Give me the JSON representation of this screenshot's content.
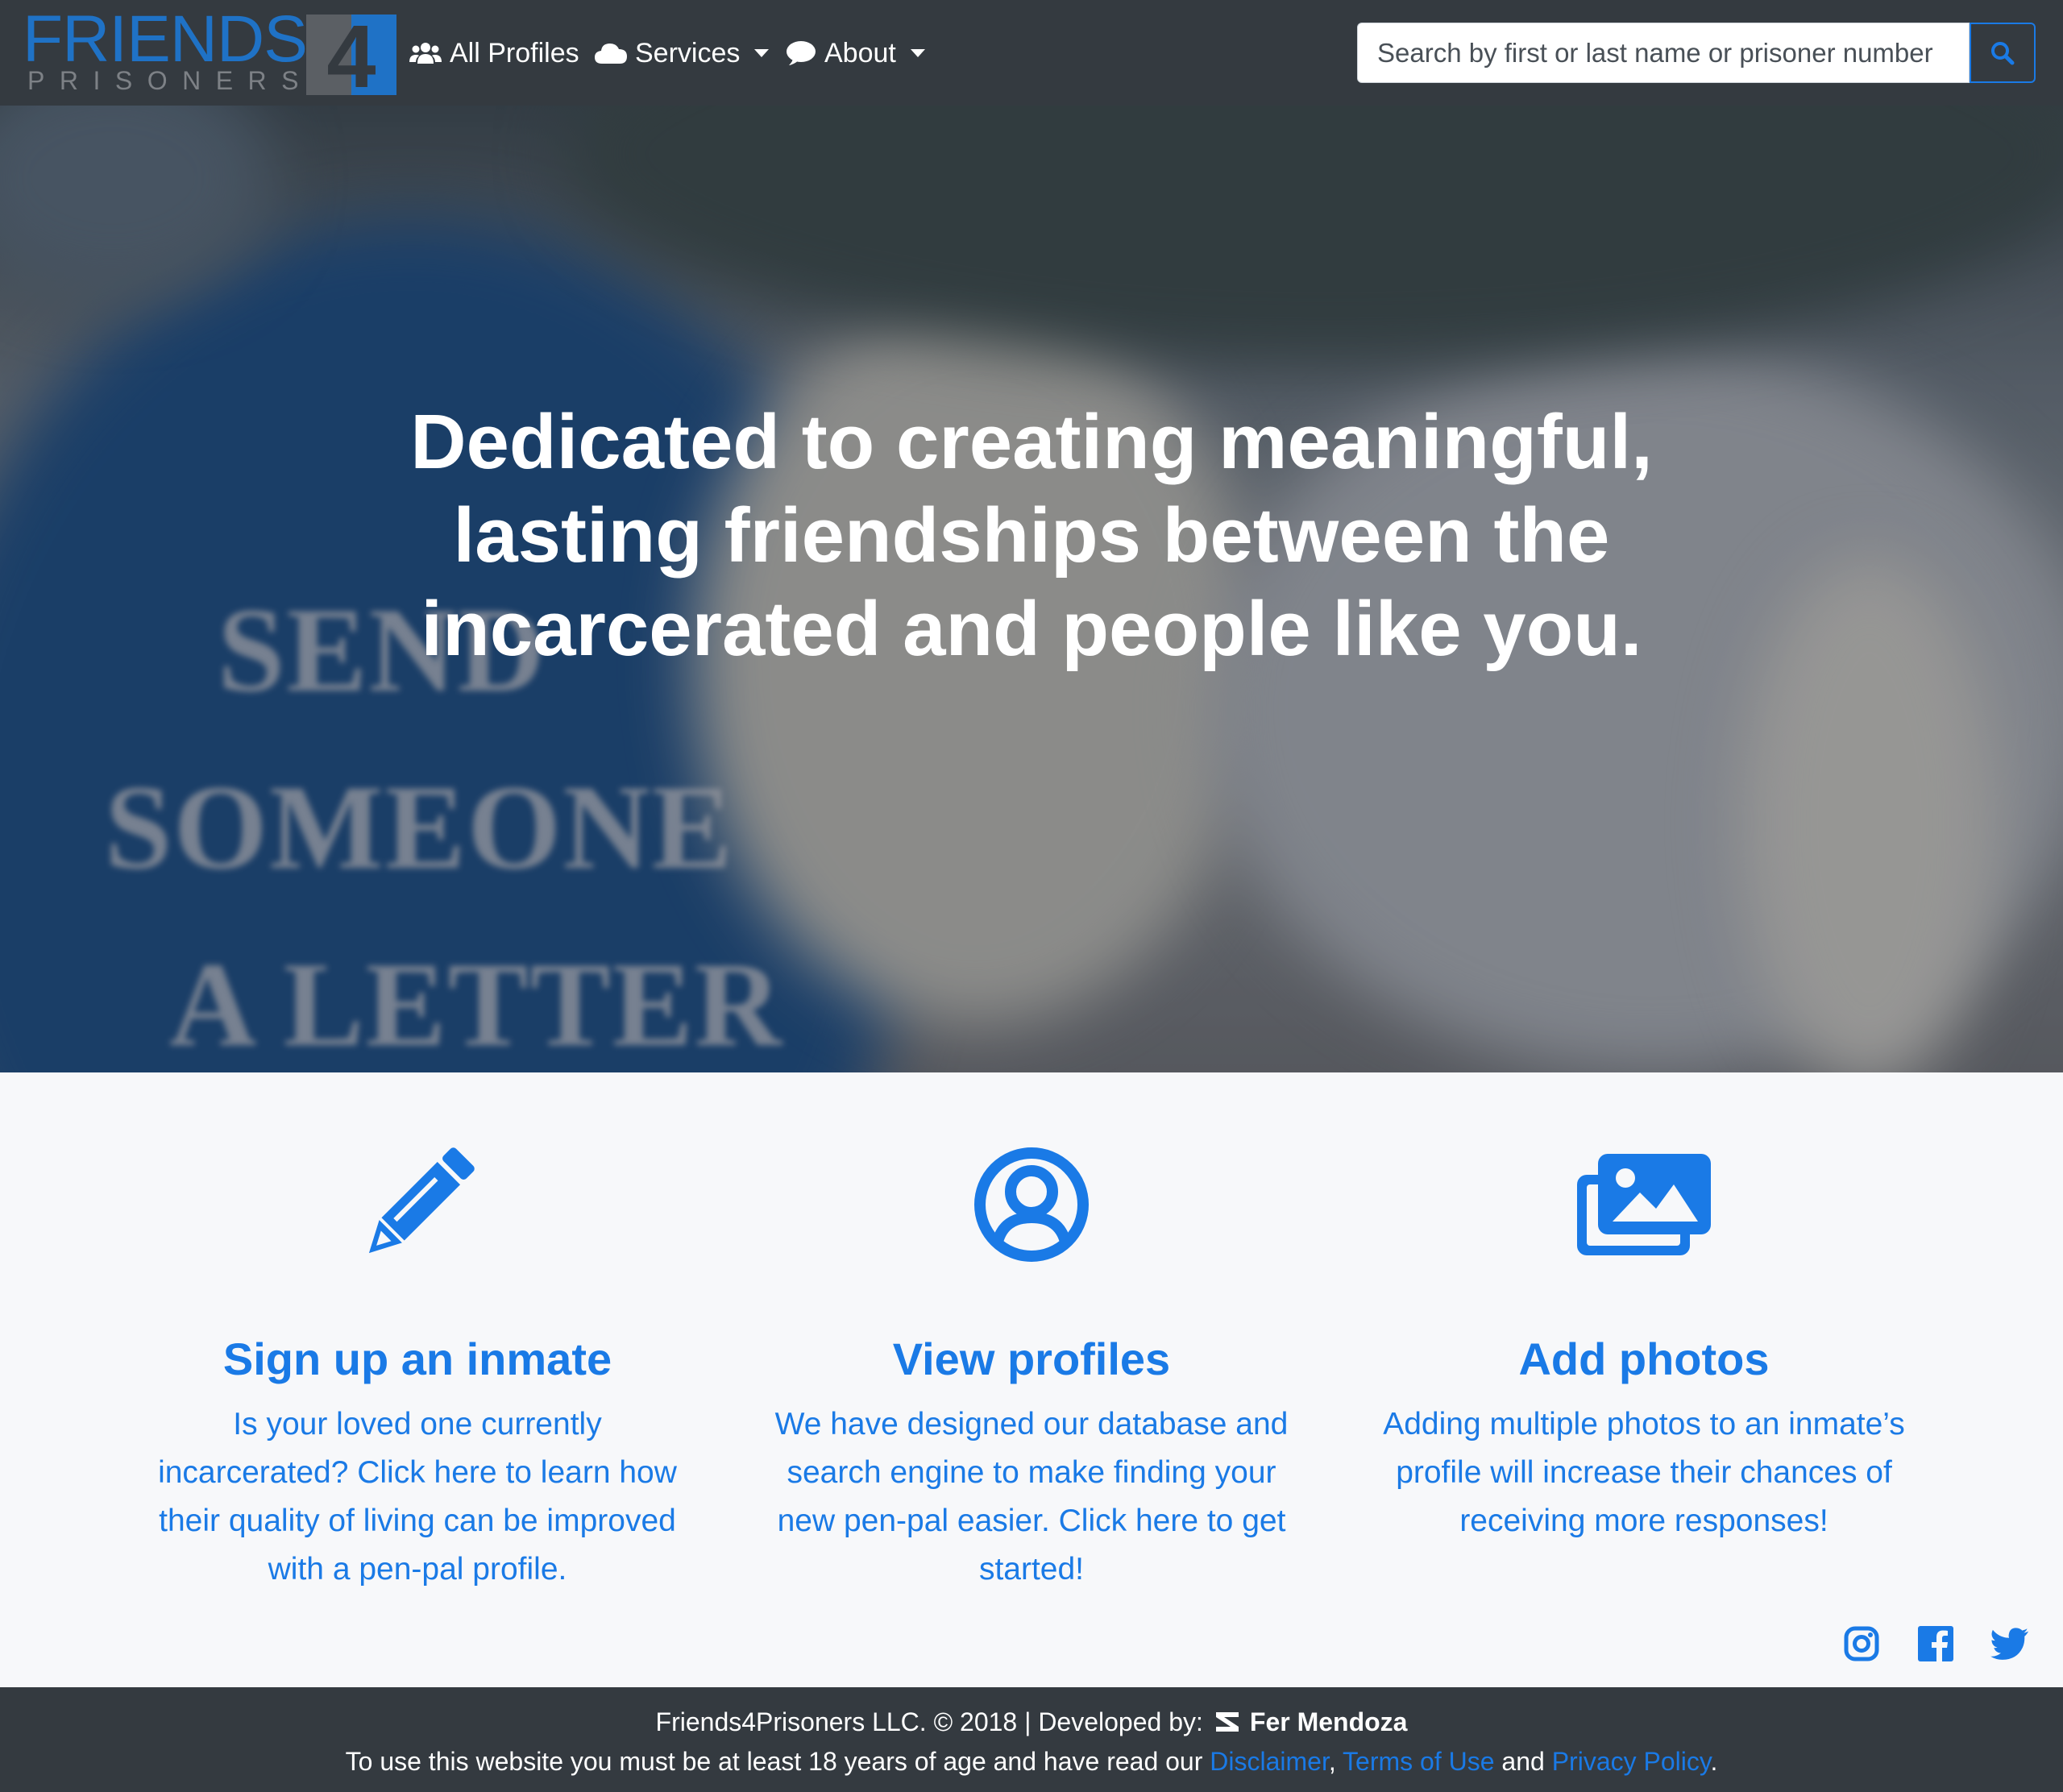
{
  "brand": {
    "logo_word": "FRIENDS",
    "logo_sub": "PRISONERS",
    "logo_digit": "4"
  },
  "nav": {
    "items": [
      {
        "label": "All Profiles",
        "icon": "users-icon"
      },
      {
        "label": "Services",
        "icon": "cloud-icon",
        "dropdown": true
      },
      {
        "label": "About",
        "icon": "comment-icon",
        "dropdown": true
      }
    ],
    "search_placeholder": "Search by first or last name or prisoner number",
    "search_icon": "search-icon"
  },
  "hero": {
    "title": "Dedicated to creating meaningful, lasting friendships between the incarcerated and people like you.",
    "mailbox_lines": [
      "SEND",
      "SOMEONE",
      "A LETTER"
    ]
  },
  "features": [
    {
      "icon": "pencil-icon",
      "title": "Sign up an inmate",
      "text": "Is your loved one currently incarcerated? Click here to learn how their quality of living can be improved with a pen-pal profile."
    },
    {
      "icon": "user-circle-icon",
      "title": "View profiles",
      "text": "We have designed our database and search engine to make finding your new pen-pal easier. Click here to get started!"
    },
    {
      "icon": "images-icon",
      "title": "Add photos",
      "text": "Adding multiple photos to an inmate’s profile will increase their chances of receiving more responses!"
    }
  ],
  "social": [
    "instagram-icon",
    "facebook-icon",
    "twitter-icon"
  ],
  "footer": {
    "copyright": "Friends4Prisoners LLC. © 2018 | Developed by:",
    "developer": "Fer Mendoza",
    "notice_prefix": "To use this website you must be at least 18 years of age and have read our",
    "disclaimer": "Disclaimer",
    "comma": ",",
    "terms": "Terms of Use",
    "and": "and",
    "privacy": "Privacy Policy",
    "period": "."
  },
  "colors": {
    "navbar": "#343a40",
    "accent": "#1a7ae6",
    "logo_blue": "#1f72c6",
    "page_bg": "#f7f8fa"
  }
}
